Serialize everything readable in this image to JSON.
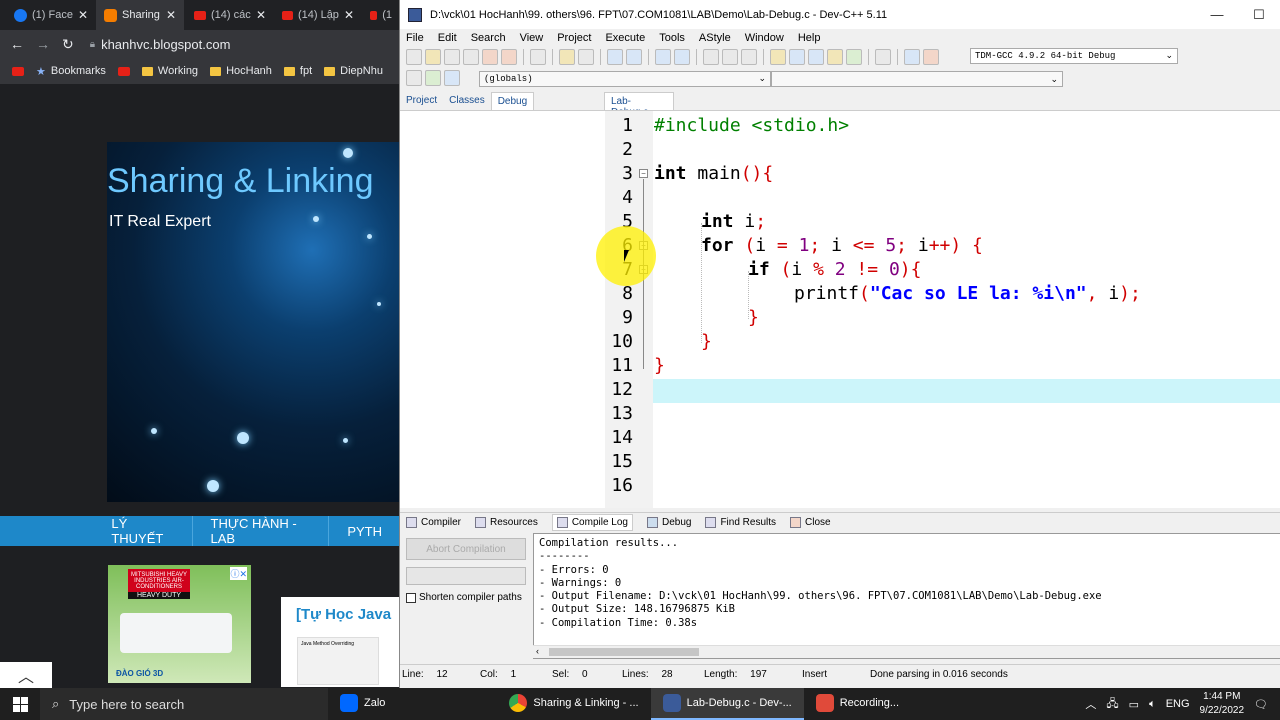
{
  "browser": {
    "tabs": [
      {
        "label": "(1) Face",
        "color": "#1877f2"
      },
      {
        "label": "Sharing",
        "color": "#f57d00"
      },
      {
        "label": "(14) các",
        "color": "#e62117"
      },
      {
        "label": "(14) Lập",
        "color": "#e62117"
      },
      {
        "label": "(1",
        "color": "#e62117"
      }
    ],
    "url": "khanhvc.blogspot.com",
    "bookmarks": [
      "Bookmarks",
      "Working",
      "HocHanh",
      "fpt",
      "DiepNhu"
    ],
    "page": {
      "hero_title": "Sharing & Linking",
      "hero_subtitle": "IT Real Expert",
      "nav": [
        "LÝ THUYẾT",
        "THỰC HÀNH - LAB",
        "PYTH"
      ],
      "ad_brand": "MITSUBISHI HEAVY INDUSTRIES AIR-CONDITIONERS",
      "ad_tag": "HEAVY DUTY",
      "ad_text": "ĐÀO GIÓ 3D",
      "post_title": "[Tự Học Java",
      "post_thumb_text": "Java Method Overriding",
      "scroll_up": "^"
    }
  },
  "devcpp": {
    "title": "D:\\vck\\01 HocHanh\\99. others\\96. FPT\\07.COM1081\\LAB\\Demo\\Lab-Debug.c - Dev-C++ 5.11",
    "menu": [
      "File",
      "Edit",
      "Search",
      "View",
      "Project",
      "Execute",
      "Tools",
      "AStyle",
      "Window",
      "Help"
    ],
    "compiler": "TDM-GCC 4.9.2 64-bit Debug",
    "scope": "(globals)",
    "left_tabs": [
      "Project",
      "Classes",
      "Debug"
    ],
    "file_tab": "Lab-Debug.c",
    "line_numbers": [
      "1",
      "2",
      "3",
      "4",
      "5",
      "6",
      "7",
      "8",
      "9",
      "10",
      "11",
      "12",
      "13",
      "14",
      "15",
      "16"
    ],
    "code": {
      "l1": "#include <stdio.h>",
      "l3_kw": "int",
      "l3_rest": " main",
      "l3_paren": "(){",
      "l5_kw": "int",
      "l5_rest": " i",
      "l5_semi": ";",
      "l6_kw": "for",
      "l6_a": " (",
      "l6_b": "i ",
      "l6_c": "= ",
      "l6_d": "1",
      "l6_e": "; ",
      "l6_f": "i ",
      "l6_g": "<= ",
      "l6_h": "5",
      "l6_i": "; ",
      "l6_j": "i",
      "l6_k": "++) {",
      "l7_kw": "if",
      "l7_a": " (",
      "l7_b": "i ",
      "l7_c": "% ",
      "l7_d": "2",
      "l7_e": " != ",
      "l7_f": "0",
      "l7_g": "){",
      "l8_fn": "printf",
      "l8_a": "(",
      "l8_str": "\"Cac so LE la: %i\\n\"",
      "l8_b": ", ",
      "l8_c": "i",
      "l8_d": ");",
      "l9": "}",
      "l10": "}",
      "l11": "}"
    },
    "bottom_tabs": [
      "Compiler",
      "Resources",
      "Compile Log",
      "Debug",
      "Find Results",
      "Close"
    ],
    "abort_label": "Abort Compilation",
    "shorten_label": "Shorten compiler paths",
    "log_lines": [
      "Compilation results...",
      "--------",
      "- Errors: 0",
      "- Warnings: 0",
      "- Output Filename: D:\\vck\\01 HocHanh\\99. others\\96. FPT\\07.COM1081\\LAB\\Demo\\Lab-Debug.exe",
      "- Output Size: 148.16796875 KiB",
      "- Compilation Time: 0.38s"
    ],
    "status": {
      "line_label": "Line:",
      "line": "12",
      "col_label": "Col:",
      "col": "1",
      "sel_label": "Sel:",
      "sel": "0",
      "lines_label": "Lines:",
      "lines": "28",
      "length_label": "Length:",
      "length": "197",
      "mode": "Insert",
      "message": "Done parsing in 0.016 seconds"
    }
  },
  "taskbar": {
    "search_placeholder": "Type here to search",
    "apps": [
      {
        "label": "Zalo",
        "color": "#0068ff"
      },
      {
        "label": "Sharing & Linking - ...",
        "color": "#4285f4"
      },
      {
        "label": "Lab-Debug.c - Dev-...",
        "color": "#3b5b99"
      },
      {
        "label": "Recording...",
        "color": "#e04a3a"
      }
    ],
    "lang": "ENG",
    "time": "1:44 PM",
    "date": "9/22/2022"
  }
}
